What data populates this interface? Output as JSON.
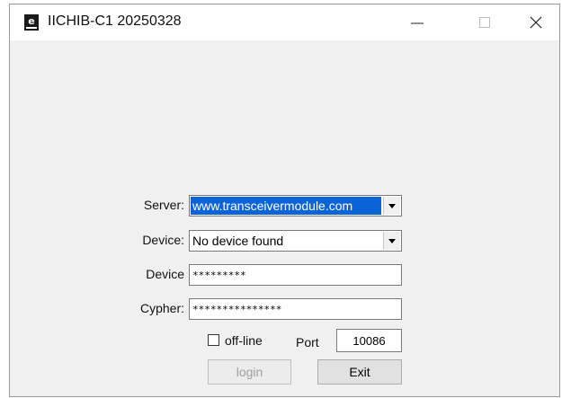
{
  "window": {
    "title": "IICHIB-C1 20250328",
    "minimize_icon": "minimize-icon",
    "maximize_icon": "maximize-icon",
    "close_icon": "close-icon"
  },
  "form": {
    "server": {
      "label": "Server:",
      "value": "www.transceivermodule.com"
    },
    "device_select": {
      "label": "Device:",
      "value": "No device found"
    },
    "device_password": {
      "label": "Device",
      "value": "*********"
    },
    "cypher": {
      "label": "Cypher:",
      "value": "***************"
    },
    "offline": {
      "label": "off-line",
      "checked": false
    },
    "port": {
      "label": "Port",
      "value": "10086"
    }
  },
  "buttons": {
    "login": "login",
    "exit": "Exit"
  },
  "colors": {
    "selection": "#0a64d7",
    "window_bg": "#f0f0f0"
  }
}
